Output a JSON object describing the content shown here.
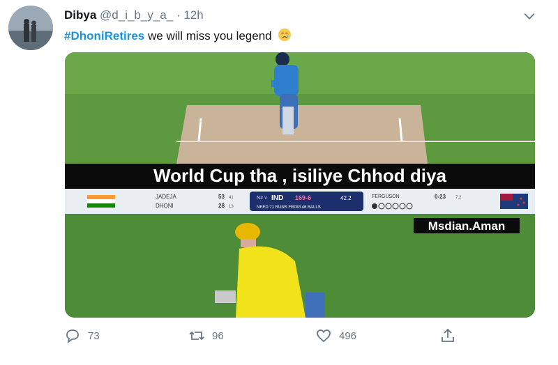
{
  "tweet": {
    "author_name": "Dibya",
    "author_handle": "@d_i_b_y_a_",
    "separator": "·",
    "time": "12h",
    "hashtag": "#DhoniRetires",
    "text": "we will miss you legend"
  },
  "media": {
    "caption": "World Cup tha , isiliye Chhod diya",
    "watermark": "Msdian.Aman",
    "scoreboard": {
      "batsman1": "JADEJA",
      "batsman2": "DHONI",
      "score1": "53",
      "score1_balls": "41",
      "score2": "28",
      "score2_balls": "13",
      "team_left": "NZ v",
      "team": "IND",
      "score": "169-6",
      "overs": "42.2",
      "need": "NEED 71 RUNS FROM 46 BALLS",
      "bowler": "FERGUSON",
      "bowler_figures": "0-23",
      "bowler_overs": "7.2"
    }
  },
  "actions": {
    "reply_count": "73",
    "retweet_count": "96",
    "like_count": "496"
  },
  "icons": {
    "reply": "reply-icon",
    "retweet": "retweet-icon",
    "like": "heart-icon",
    "share": "share-icon",
    "menu": "chevron-down-icon"
  },
  "colors": {
    "hashtag": "#1b95e0",
    "muted": "#657786"
  }
}
